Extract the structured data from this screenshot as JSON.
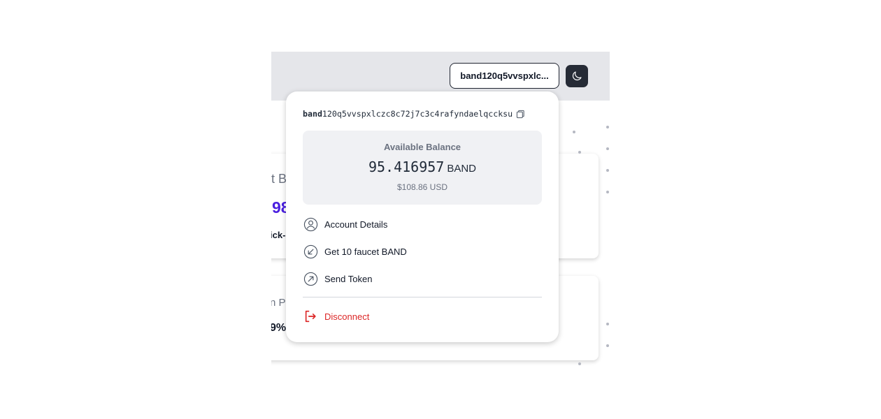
{
  "header": {
    "wallet_button_label": "band120q5vvspxlc...",
    "theme_toggle_icon": "moon-icon"
  },
  "background_fragments": {
    "card1_title": "t B",
    "card1_value": "98",
    "card1_link": "ick-",
    "card2_title": "n P",
    "card2_value": "9%"
  },
  "dropdown": {
    "address_prefix": "band",
    "address_rest": "120q5vvspxlczc8c72j7c3c4rafyndaelqccksu",
    "balance": {
      "label": "Available Balance",
      "amount": "95.416957",
      "unit": "BAND",
      "usd": "$108.86 USD"
    },
    "menu": [
      {
        "label": "Account Details",
        "icon": "user-circle-icon"
      },
      {
        "label": "Get 10 faucet BAND",
        "icon": "arrow-down-left-circle-icon"
      },
      {
        "label": "Send Token",
        "icon": "arrow-up-right-circle-icon"
      }
    ],
    "disconnect_label": "Disconnect",
    "disconnect_icon": "logout-icon"
  },
  "colors": {
    "accent": "#4a1fe0",
    "danger": "#dc2626",
    "topbar": "#e5e6ea",
    "dark_button": "#262b36"
  }
}
